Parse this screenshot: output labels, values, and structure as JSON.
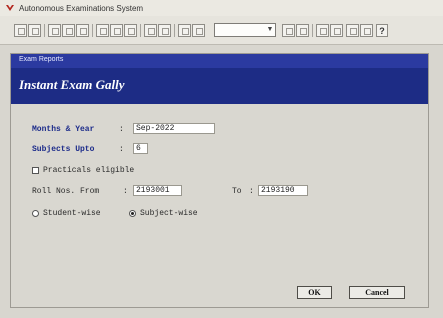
{
  "app": {
    "title": "Autonomous Examinations System"
  },
  "toolbar": {
    "combo_value": "",
    "help_glyph": "?"
  },
  "dialog": {
    "window_title": "Exam Reports",
    "header_title": "Instant Exam Gally",
    "months_year_label": "Months & Year",
    "months_year_value": "Sep-2022",
    "subjects_upto_label": "Subjects Upto",
    "subjects_upto_value": "6",
    "practicals_label": "Practicals eligible",
    "practicals_checked": false,
    "roll_from_label": "Roll Nos. From",
    "roll_from_value": "2193001",
    "roll_to_label": "To",
    "roll_to_value": "2193190",
    "radio_student_label": "Student-wise",
    "radio_subject_label": "Subject-wise",
    "selected_mode": "Subject-wise",
    "ok_label": "OK",
    "cancel_label": "Cancel"
  },
  "colors": {
    "header_band": "#1d2c85",
    "title_bar": "#2b3aa0",
    "label_text": "#1c2b8a"
  }
}
